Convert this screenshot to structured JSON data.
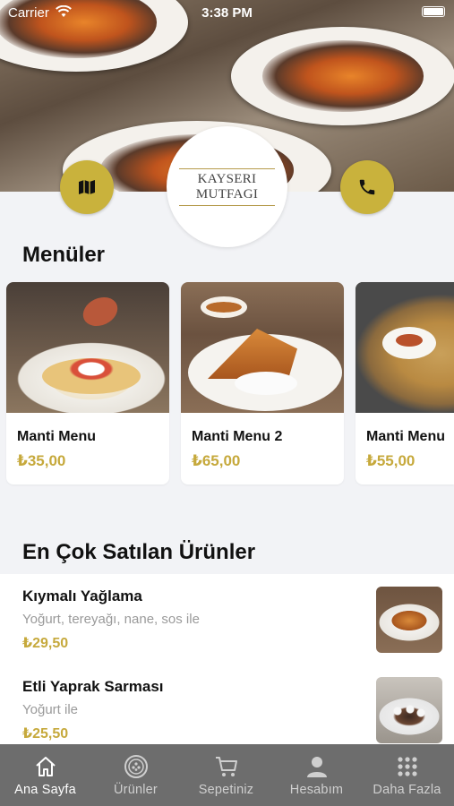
{
  "status_bar": {
    "carrier": "Carrier",
    "time": "3:38 PM"
  },
  "header": {
    "logo_text": "KAYSERI MUTFAGI",
    "map_icon": "map-icon",
    "phone_icon": "phone-icon",
    "accent_color": "#c9b23c"
  },
  "menus": {
    "title": "Menüler",
    "items": [
      {
        "name": "Manti Menu",
        "price": "₺35,00"
      },
      {
        "name": "Manti Menu 2",
        "price": "₺65,00"
      },
      {
        "name": "Manti Menu",
        "price": "₺55,00"
      }
    ]
  },
  "best_sellers": {
    "title": "En Çok Satılan Ürünler",
    "items": [
      {
        "name": "Kıymalı Yağlama",
        "description": "Yoğurt, tereyağı, nane, sos ile",
        "price": "₺29,50"
      },
      {
        "name": "Etli Yaprak Sarması",
        "description": "Yoğurt ile",
        "price": "₺25,50"
      }
    ]
  },
  "tabbar": {
    "items": [
      {
        "label": "Ana Sayfa",
        "icon": "home-icon",
        "active": true
      },
      {
        "label": "Ürünler",
        "icon": "products-icon",
        "active": false
      },
      {
        "label": "Sepetiniz",
        "icon": "cart-icon",
        "active": false
      },
      {
        "label": "Hesabım",
        "icon": "account-icon",
        "active": false
      },
      {
        "label": "Daha Fazla",
        "icon": "more-icon",
        "active": false
      }
    ]
  },
  "colors": {
    "price": "#c6a93c",
    "tabbar_bg": "#6d6d6d",
    "page_bg": "#f2f3f6"
  }
}
